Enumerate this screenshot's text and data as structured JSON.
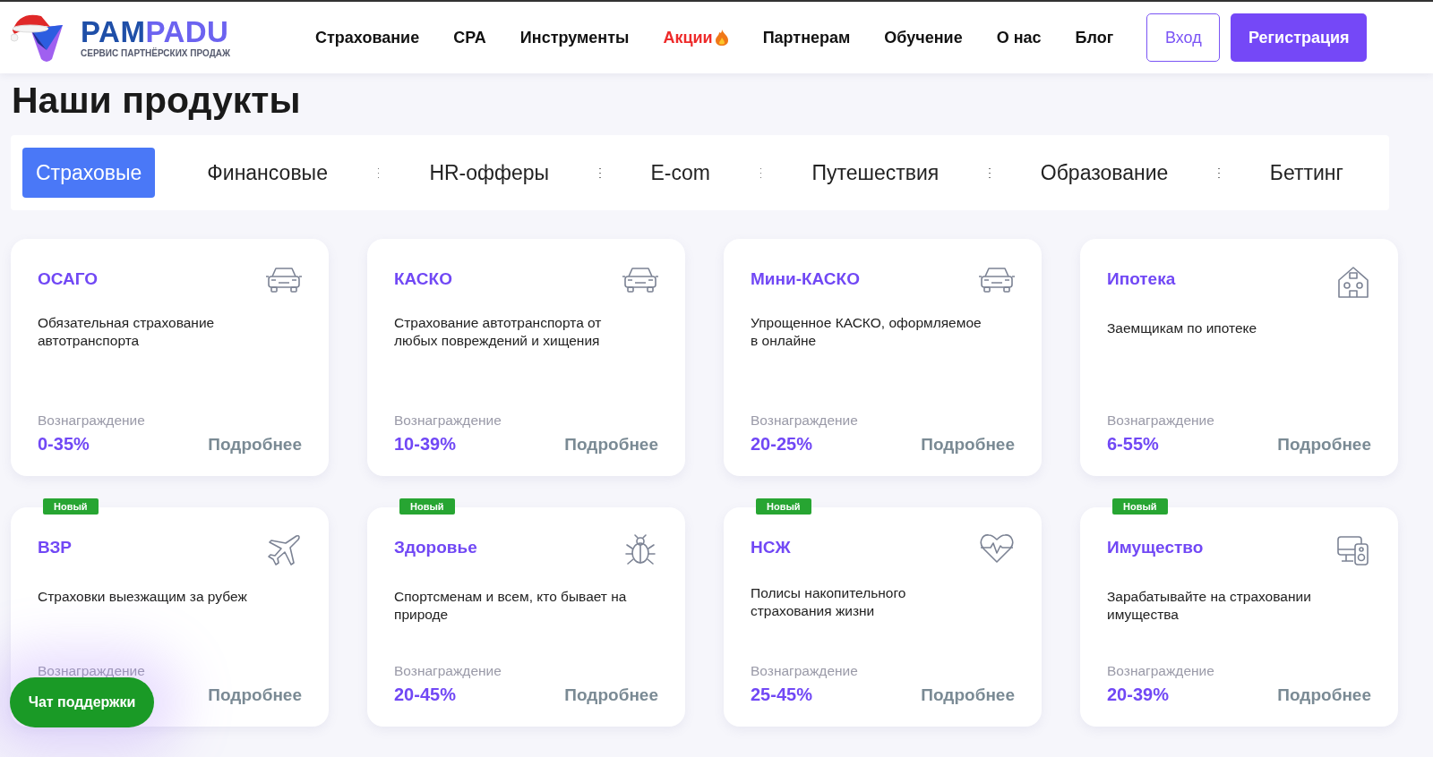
{
  "logo": {
    "name_part1": "PAM",
    "name_part2": "PADU",
    "tagline": "СЕРВИС ПАРТНЁРСКИХ ПРОДАЖ"
  },
  "nav": [
    {
      "label": "Страхование",
      "promo": false
    },
    {
      "label": "CPA",
      "promo": false
    },
    {
      "label": "Инструменты",
      "promo": false
    },
    {
      "label": "Акции",
      "promo": true
    },
    {
      "label": "Партнерам",
      "promo": false
    },
    {
      "label": "Обучение",
      "promo": false
    },
    {
      "label": "О нас",
      "promo": false
    },
    {
      "label": "Блог",
      "promo": false
    }
  ],
  "login_button": "Вход",
  "register_button": "Регистрация",
  "page_title": "Наши продукты",
  "tabs": [
    {
      "label": "Страховые",
      "selected": true
    },
    {
      "label": "Финансовые",
      "selected": false
    },
    {
      "label": "HR-офферы",
      "selected": false
    },
    {
      "label": "E-com",
      "selected": false
    },
    {
      "label": "Путешествия",
      "selected": false
    },
    {
      "label": "Образование",
      "selected": false
    },
    {
      "label": "Беттинг",
      "selected": false
    }
  ],
  "products": [
    {
      "title": "ОСАГО",
      "description": "Обязательная страхование автотранспорта",
      "reward_label": "Вознаграждение",
      "reward": "0-35%",
      "more": "Подробнее"
    },
    {
      "title": "КАСКО",
      "description": "Страхование автотранспорта от любых повреждений и хищения",
      "reward_label": "Вознаграждение",
      "reward": "10-39%",
      "more": "Подробнее"
    },
    {
      "title": "Мини-КАСКО",
      "description": "Упрощенное КАСКО, оформляемое в онлайне",
      "reward_label": "Вознаграждение",
      "reward": "20-25%",
      "more": "Подробнее"
    },
    {
      "title": "Ипотека",
      "description": "Заемщикам по ипотеке",
      "reward_label": "Вознаграждение",
      "reward": "6-55%",
      "more": "Подробнее"
    },
    {
      "badge": "Новый",
      "title": "ВЗР",
      "description": "Страховки выезжащим за рубеж",
      "reward_label": "Вознаграждение",
      "more": "Подробнее"
    },
    {
      "badge": "Новый",
      "title": "Здоровье",
      "description": "Спортсменам и всем, кто бывает на природе",
      "reward_label": "Вознаграждение",
      "reward": "20-45%",
      "more": "Подробнее"
    },
    {
      "badge": "Новый",
      "title": "НСЖ",
      "description": "Полисы накопительного страхования жизни",
      "reward_label": "Вознаграждение",
      "reward": "25-45%",
      "more": "Подробнее"
    },
    {
      "badge": "Новый",
      "title": "Имущество",
      "description": "Зарабатывайте на страховании имущества",
      "reward_label": "Вознаграждение",
      "reward": "20-39%",
      "more": "Подробнее"
    }
  ],
  "chat_button": "Чат поддержки"
}
